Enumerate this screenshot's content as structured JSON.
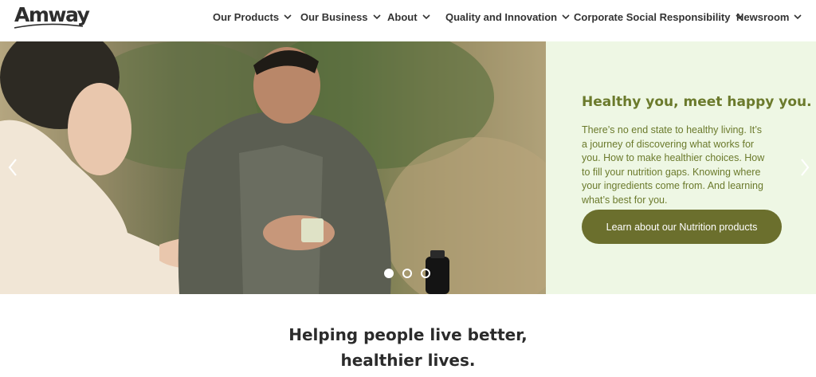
{
  "brand": {
    "logo_text": "Amway"
  },
  "nav": {
    "items": [
      {
        "label": "Our Products"
      },
      {
        "label": "Our Business"
      },
      {
        "label": "About"
      },
      {
        "label": "Quality and Innovation"
      },
      {
        "label": "Corporate Social Responsibility"
      },
      {
        "label": "Newsroom"
      }
    ]
  },
  "hero": {
    "title": "Healthy you, meet happy you.",
    "body": "There’s no end state to healthy living. It’s a journey of discovering what works for you. How to make healthier choices. How to fill your nutrition gaps. Knowing where your ingredients come from. And learning what’s best for you.",
    "cta_label": "Learn about our Nutrition products",
    "slide_count": 3,
    "active_slide": 1,
    "colors": {
      "title": "#6b7a2c",
      "panel_bg": "#eef7e4",
      "button_bg": "#6b6f2d"
    }
  },
  "headline": {
    "line1": "Helping people live better,",
    "line2": "healthier lives."
  }
}
